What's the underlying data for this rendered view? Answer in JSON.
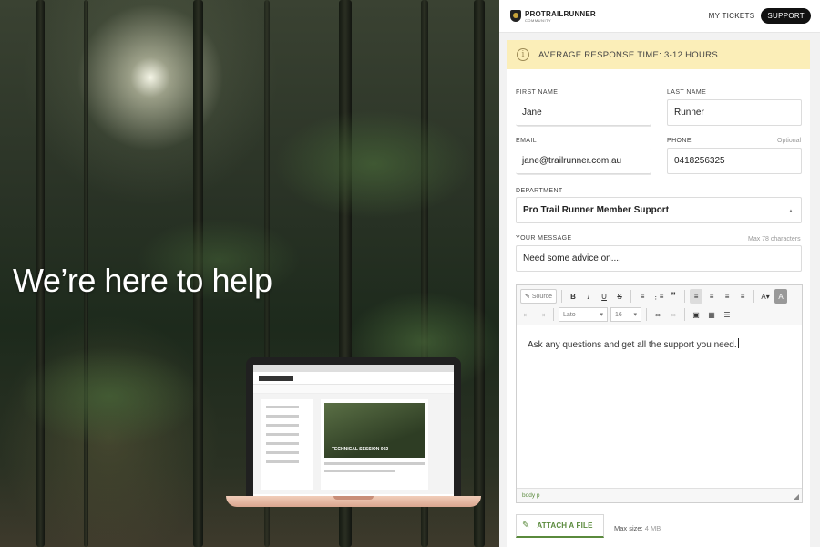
{
  "hero": {
    "title": "We’re here to help",
    "laptop_video_caption": "TECHNICAL SESSION 002"
  },
  "topbar": {
    "brand_name": "PROTRAILRUNNER",
    "brand_sub": "COMMUNITY",
    "my_tickets": "MY TICKETS",
    "support": "SUPPORT"
  },
  "notice": {
    "icon": "info-icon",
    "text": "AVERAGE RESPONSE TIME: 3-12 HOURS",
    "background": "#fbeeb8"
  },
  "form": {
    "first_name": {
      "label": "FIRST NAME",
      "value": "Jane"
    },
    "last_name": {
      "label": "LAST NAME",
      "value": "Runner"
    },
    "email": {
      "label": "EMAIL",
      "value": "jane@trailrunner.com.au"
    },
    "phone": {
      "label": "PHONE",
      "optional": "Optional",
      "value": "0418256325"
    },
    "department": {
      "label": "DEPARTMENT",
      "value": "Pro Trail Runner Member Support"
    },
    "message_subject": {
      "label": "YOUR MESSAGE",
      "hint": "Max 78 characters",
      "value": "Need some advice on...."
    }
  },
  "editor": {
    "source_label": "Source",
    "font_label": "Lato",
    "size_label": "16",
    "body_text": "Ask any questions and get all the support you need.",
    "status_path": "body  p",
    "accent_color": "#5a8a3c"
  },
  "attach": {
    "label": "ATTACH A FILE",
    "max_label": "Max size:",
    "max_value": "4 MB"
  }
}
